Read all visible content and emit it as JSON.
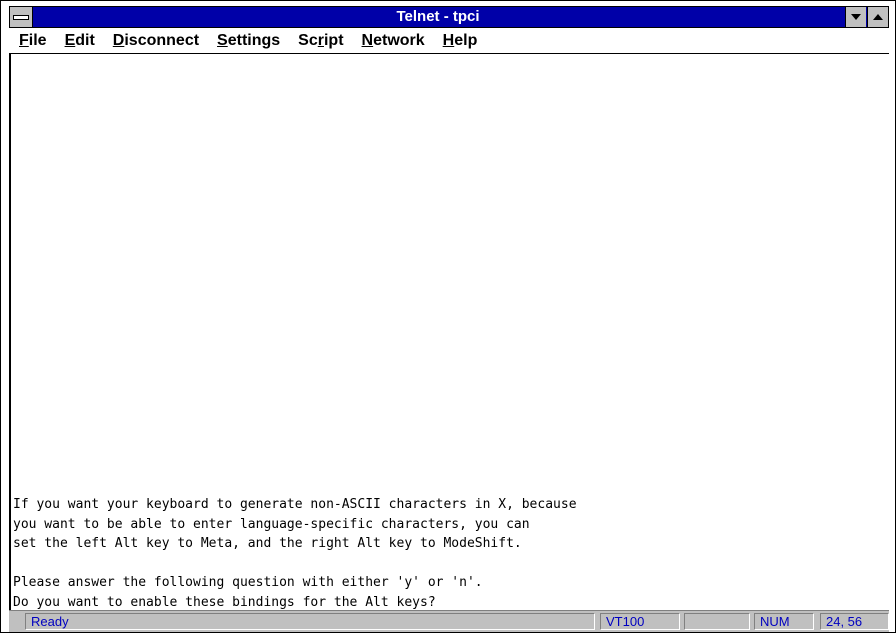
{
  "window": {
    "title": "Telnet - tpci"
  },
  "menu": {
    "items": [
      {
        "pre": "",
        "ul": "F",
        "post": "ile"
      },
      {
        "pre": "",
        "ul": "E",
        "post": "dit"
      },
      {
        "pre": "",
        "ul": "D",
        "post": "isconnect"
      },
      {
        "pre": "",
        "ul": "S",
        "post": "ettings"
      },
      {
        "pre": "Sc",
        "ul": "r",
        "post": "ipt"
      },
      {
        "pre": "",
        "ul": "N",
        "post": "etwork"
      },
      {
        "pre": "",
        "ul": "H",
        "post": "elp"
      }
    ]
  },
  "terminal": {
    "lines": [
      "If you want your keyboard to generate non-ASCII characters in X, because",
      "you want to be able to enter language-specific characters, you can",
      "set the left Alt key to Meta, and the right Alt key to ModeShift.",
      "",
      "Please answer the following question with either 'y' or 'n'.",
      "Do you want to enable these bindings for the Alt keys?"
    ]
  },
  "status": {
    "message": "Ready",
    "emulation": "VT100",
    "blank": "",
    "numlock": "NUM",
    "cursor": "24, 56"
  },
  "colors": {
    "titlebar": "#0000a8",
    "status_text": "#0000c0",
    "chrome": "#c0c0c0"
  }
}
